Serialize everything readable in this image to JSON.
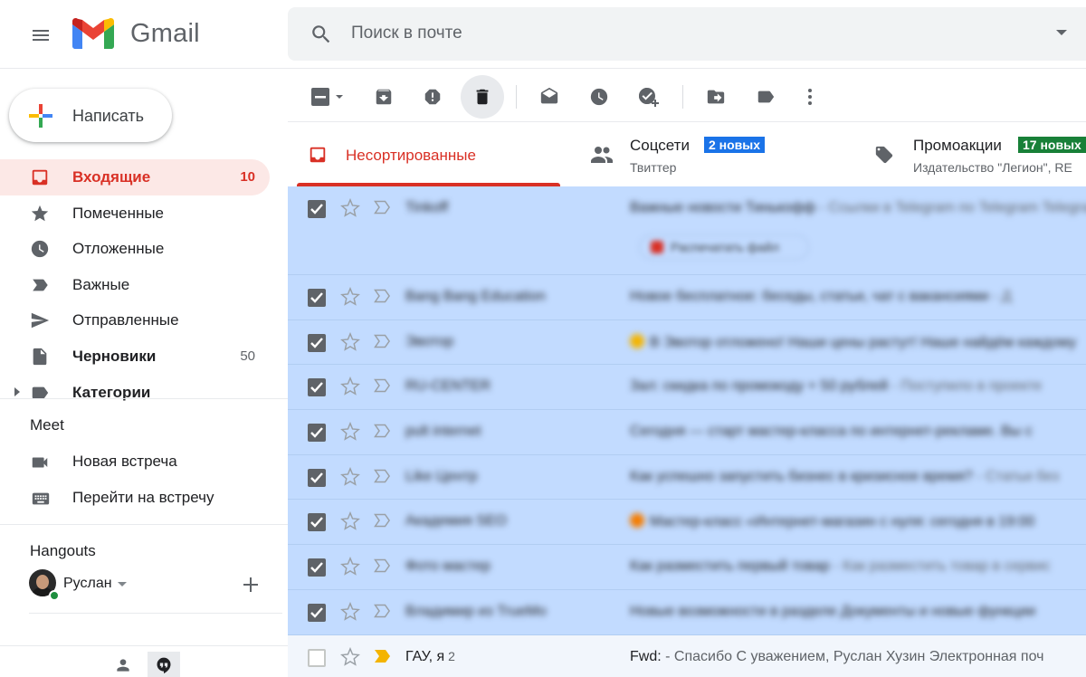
{
  "header": {
    "app_name": "Gmail",
    "search_placeholder": "Поиск в почте"
  },
  "compose": {
    "label": "Написать"
  },
  "sidebar": {
    "items": [
      {
        "label": "Входящие",
        "count": "10",
        "icon": "inbox-icon"
      },
      {
        "label": "Помеченные",
        "count": "",
        "icon": "star-icon"
      },
      {
        "label": "Отложенные",
        "count": "",
        "icon": "clock-icon"
      },
      {
        "label": "Важные",
        "count": "",
        "icon": "label-important-icon"
      },
      {
        "label": "Отправленные",
        "count": "",
        "icon": "send-icon"
      },
      {
        "label": "Черновики",
        "count": "50",
        "icon": "draft-icon"
      },
      {
        "label": "Категории",
        "count": "",
        "icon": "label-icon"
      }
    ]
  },
  "meet": {
    "title": "Meet",
    "new_meeting": "Новая встреча",
    "join_meeting": "Перейти на встречу"
  },
  "hangouts": {
    "title": "Hangouts",
    "user": "Руслан"
  },
  "tabs": [
    {
      "name": "Несортированные",
      "sub": "",
      "badge": ""
    },
    {
      "name": "Соцсети",
      "sub": "Твиттер",
      "badge": "2 новых",
      "badge_color": "#1a73e8"
    },
    {
      "name": "Промоакции",
      "sub": "Издательство \"Легион\", RE",
      "badge": "17 новых",
      "badge_color": "#188038"
    }
  ],
  "emails": [
    {
      "sender": "Tinkoff",
      "subject": "Важные новости Тинькофф",
      "snippet": " - Ссылки в Telegram по Telegram Telegram",
      "attachment": "Распечатать файл",
      "selected": true
    },
    {
      "sender": "Bang Bang Education",
      "subject": "Новое бесплатное: беседы, статьи, чат с вакансиями",
      "snippet": " - Д",
      "selected": true
    },
    {
      "sender": "Эвотор",
      "subject": "В Эвотор отложено! Наши цены растут! Наше найдём каждому",
      "snippet": "",
      "emoji": true,
      "selected": true
    },
    {
      "sender": "RU-CENTER",
      "subject": "Зал: скидка по промокоду + 50 рублей",
      "snippet": " - Поступило в проекте",
      "selected": true
    },
    {
      "sender": "pult internet",
      "subject": "Сегодня — старт мастер-класса по интернет-рекламе. Вы с",
      "snippet": "",
      "selected": true
    },
    {
      "sender": "Like Центр",
      "subject": "Как успешно запустить бизнес в кризисное время?",
      "snippet": " - Статьи без",
      "selected": true
    },
    {
      "sender": "Академия SEO",
      "subject": "Мастер-класс «Интернет-магазин с нуля: сегодня в 19:00",
      "snippet": "",
      "emoji": true,
      "selected": true
    },
    {
      "sender": "Фото мастер",
      "subject": "Как разместить первый товар",
      "snippet": " - Как разместить товар в сервис",
      "selected": true
    },
    {
      "sender": "Владимир из TrueMo",
      "subject": "Новые возможности в разделе Документы и новые функции",
      "snippet": "",
      "selected": true
    },
    {
      "sender": "ГАУ, я",
      "count": "2",
      "subject": "Fwd:",
      "snippet": " - Спасибо С уважением, Руслан Хузин Электронная поч",
      "selected": false
    }
  ],
  "colors": {
    "accent": "#d93025",
    "selected_row": "#c2dbff",
    "social_badge": "#1a73e8",
    "promo_badge": "#188038"
  }
}
